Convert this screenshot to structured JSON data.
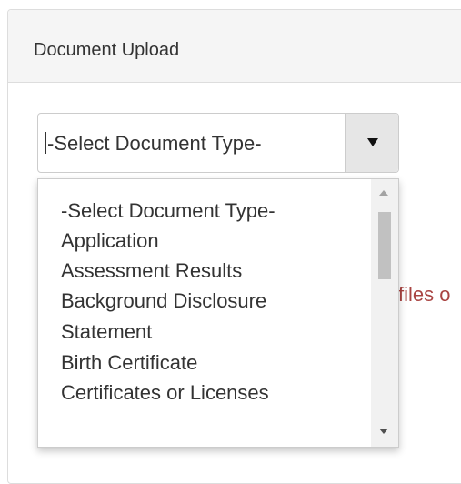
{
  "panel": {
    "title": "Document Upload"
  },
  "select": {
    "value": "-Select Document Type-"
  },
  "dropdown": {
    "items": [
      "-Select Document Type-",
      "Application",
      "Assessment Results",
      "Background Disclosure",
      "Statement",
      "Birth Certificate",
      "Certificates or Licenses"
    ],
    "scroll_position": 0.0
  },
  "background_text": {
    "partial": "files o"
  },
  "colors": {
    "heading_bg": "#f5f5f5",
    "border": "#dddddd",
    "error_text": "#a94442",
    "select_button_bg": "#e6e6e6"
  },
  "icons": {
    "select_toggle": "caret-down-icon",
    "scroll_up": "scroll-up-arrow-icon",
    "scroll_down": "scroll-down-arrow-icon"
  }
}
